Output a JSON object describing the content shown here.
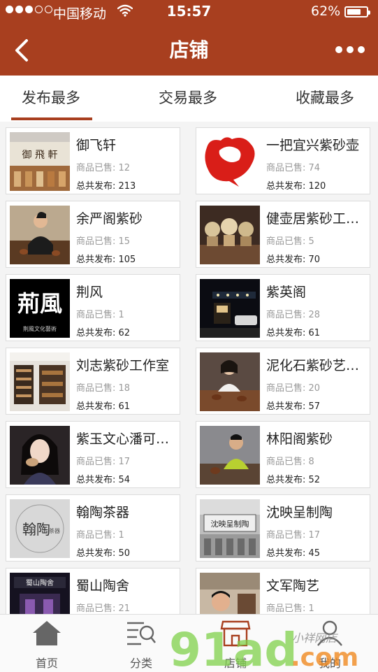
{
  "status": {
    "carrier": "中国移动",
    "time": "15:57",
    "battery": "62%",
    "battery_level": 0.62
  },
  "nav": {
    "title": "店铺"
  },
  "tabs": [
    {
      "label": "发布最多",
      "active": true
    },
    {
      "label": "交易最多",
      "active": false
    },
    {
      "label": "收藏最多",
      "active": false
    }
  ],
  "labels": {
    "sold_prefix": "商品已售: ",
    "total_prefix": "总共发布: "
  },
  "colors": {
    "brand": "#a83f1f"
  },
  "shops": [
    {
      "name": "御飞轩",
      "sold": "商品已售: 12",
      "total": "总共发布: 213",
      "thumb_text": "御 飛 軒"
    },
    {
      "name": "一把宜兴紫砂壶",
      "sold": "商品已售: 74",
      "total": "总共发布: 120"
    },
    {
      "name": "余严阁紫砂",
      "sold": "商品已售: 15",
      "total": "总共发布: 105"
    },
    {
      "name": "健壶居紫砂工…",
      "sold": "商品已售: 5",
      "total": "总共发布: 70"
    },
    {
      "name": "荆风",
      "sold": "商品已售: 1",
      "total": "总共发布: 62",
      "thumb_text": "荊風",
      "thumb_sub": "荆風文化藝術"
    },
    {
      "name": "紫英阁",
      "sold": "商品已售: 28",
      "total": "总共发布: 61"
    },
    {
      "name": "刘志紫砂工作室",
      "sold": "商品已售: 18",
      "total": "总共发布: 61"
    },
    {
      "name": "泥化石紫砂艺…",
      "sold": "商品已售: 20",
      "total": "总共发布: 57"
    },
    {
      "name": "紫玉文心潘可…",
      "sold": "商品已售: 17",
      "total": "总共发布: 54"
    },
    {
      "name": "林阳阁紫砂",
      "sold": "商品已售: 8",
      "total": "总共发布: 52"
    },
    {
      "name": "翰陶茶器",
      "sold": "商品已售: 1",
      "total": "总共发布: 50",
      "thumb_text": "翰陶",
      "thumb_sub": "茶器"
    },
    {
      "name": "沈映呈制陶",
      "sold": "商品已售: 17",
      "total": "总共发布: 45",
      "thumb_text": "沈映呈制陶"
    },
    {
      "name": "蜀山陶舍",
      "sold": "商品已售: 21",
      "total": "",
      "thumb_text": "蜀山陶舍"
    },
    {
      "name": "文军陶艺",
      "sold": "商品已售: 1",
      "total": ""
    }
  ],
  "tabbar": [
    {
      "label": "首页",
      "icon": "home-icon"
    },
    {
      "label": "分类",
      "icon": "category-search-icon"
    },
    {
      "label": "店铺",
      "icon": "shop-icon"
    },
    {
      "label": "我的",
      "icon": "user-icon"
    }
  ],
  "watermark": {
    "text": "91ad",
    "suffix": ".com",
    "script": "小祥网店"
  }
}
